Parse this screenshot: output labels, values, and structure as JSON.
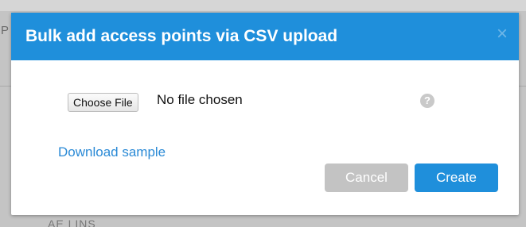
{
  "backdrop": {
    "left_fragment": "P",
    "bottom_fragment": "AE LINS"
  },
  "modal": {
    "title": "Bulk add access points via CSV upload",
    "close_label": "×",
    "file_input": {
      "button_label": "Choose File",
      "status_text": "No file chosen"
    },
    "help_label": "?",
    "download_link": "Download sample",
    "cancel_label": "Cancel",
    "create_label": "Create"
  },
  "colors": {
    "header": "#1f8fdb",
    "primary_button": "#1f8fdb",
    "disabled_button": "#c3c3c3",
    "link": "#2a8ad6"
  }
}
